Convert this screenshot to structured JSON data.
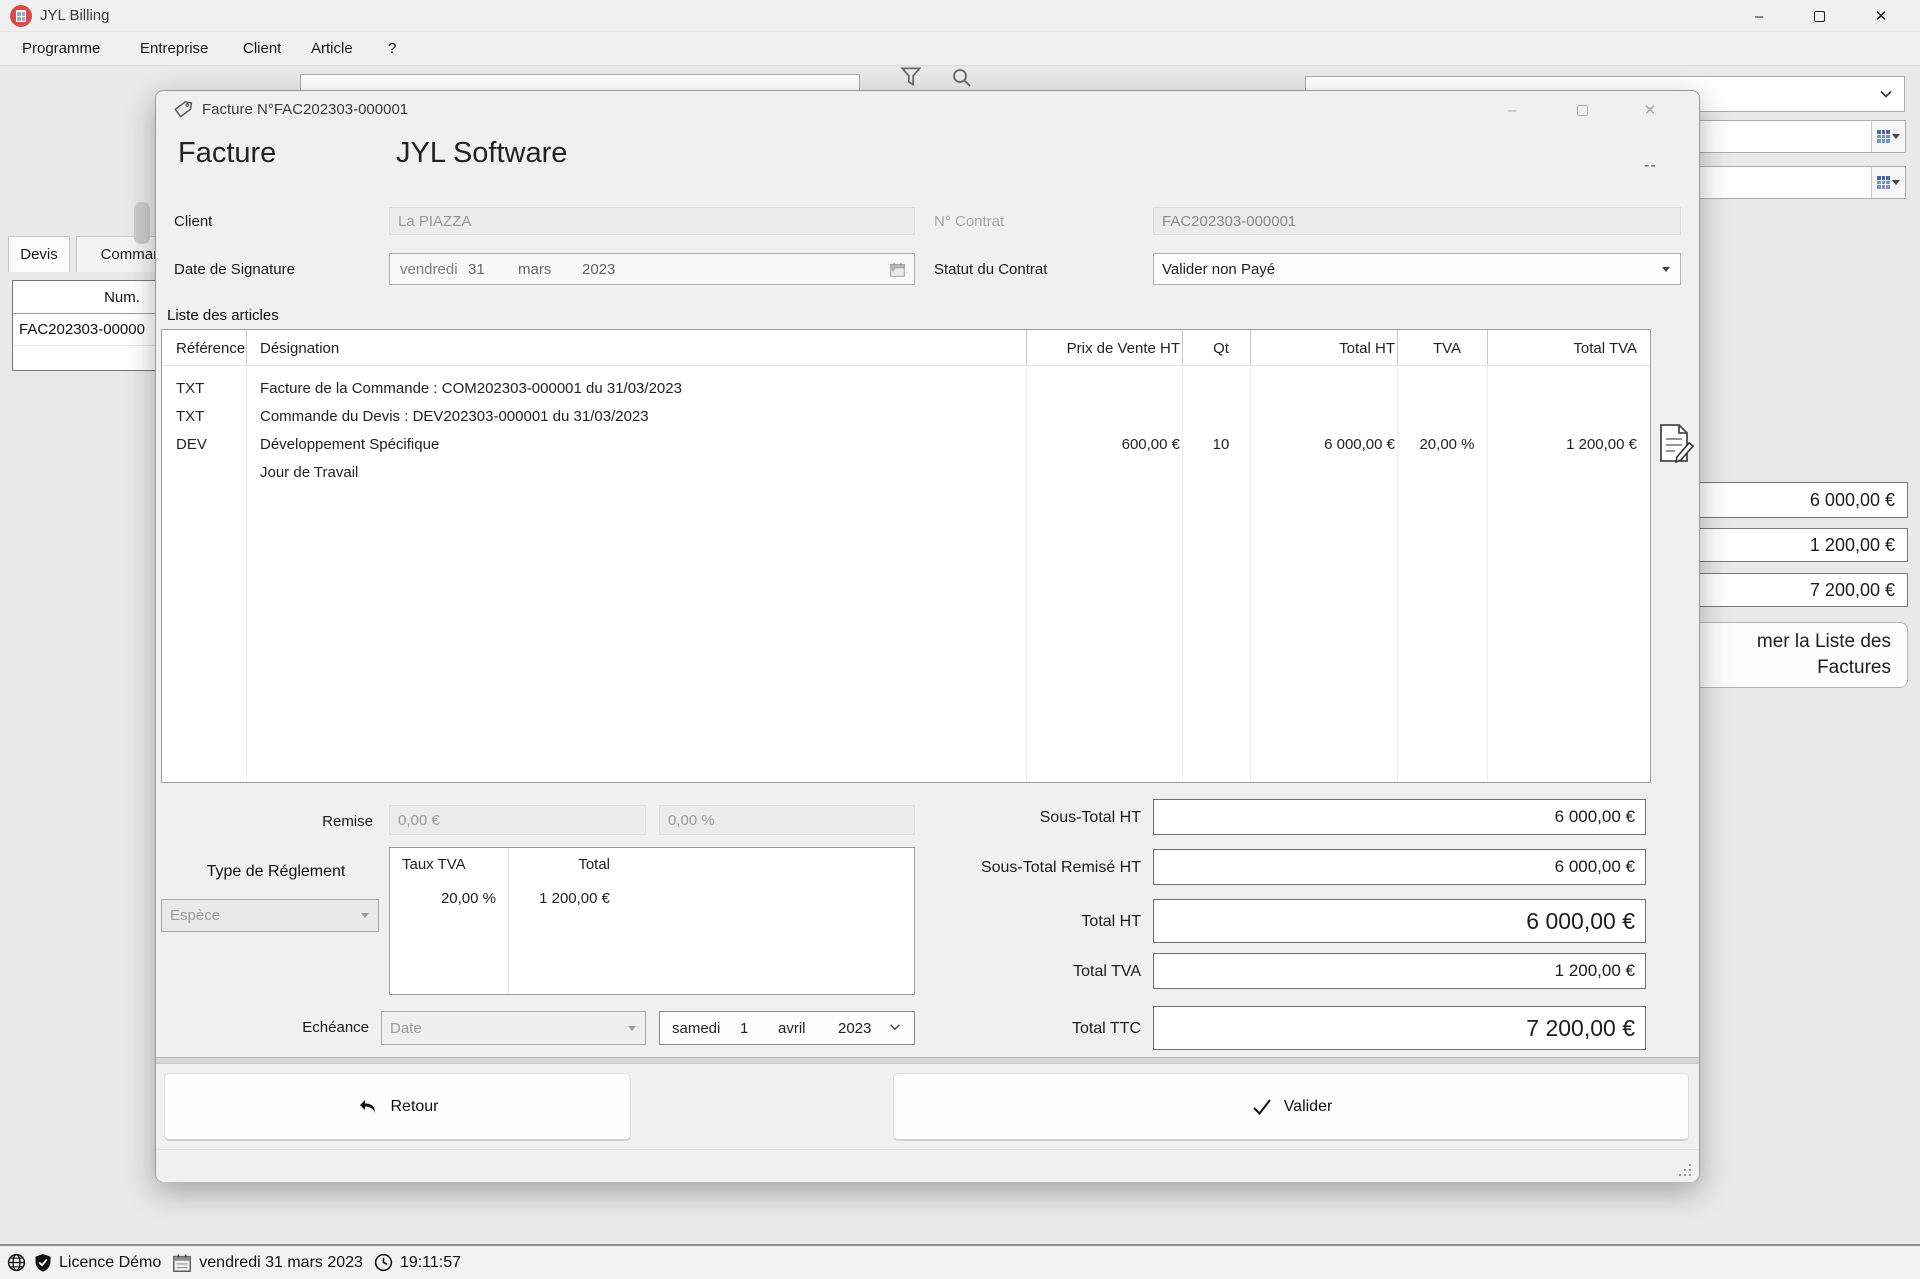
{
  "colors": {
    "window_bg": "#f0f0f0",
    "content_bg": "#e9e9e9",
    "app_icon_red": "#d84b4b",
    "field_disabled_bg": "#ebebeb",
    "border_dark": "#6f6f6f"
  },
  "app": {
    "title": "JYL Billing",
    "menu": [
      "Programme",
      "Entreprise",
      "Client",
      "Article",
      "?"
    ],
    "background": {
      "tabs": [
        "Devis",
        "Comman"
      ],
      "list": {
        "header": "Num.",
        "row": "FAC202303-00000"
      },
      "side_values": [
        "6 000,00 €",
        "1 200,00 €",
        "7 200,00 €"
      ],
      "print_button_line1": "mer la Liste des",
      "print_button_line2": "Factures"
    },
    "statusbar": {
      "licence": "Licence Démo",
      "date": "vendredi 31 mars 2023",
      "time": "19:11:57"
    }
  },
  "dialog": {
    "title": "Facture N°FAC202303-000001",
    "heading": "Facture",
    "company": "JYL Software",
    "dashes": "--",
    "fields": {
      "client_label": "Client",
      "client_value": "La PIAZZA",
      "contract_label": "N° Contrat",
      "contract_value": "FAC202303-000001",
      "signature_label": "Date de Signature",
      "signature_date": {
        "day_name": "vendredi",
        "day": "31",
        "month": "mars",
        "year": "2023"
      },
      "status_label": "Statut du Contrat",
      "status_value": "Valider non Payé"
    },
    "articles": {
      "group_title": "Liste des articles",
      "columns": [
        "Référence",
        "Désignation",
        "Prix de Vente HT",
        "Qt",
        "Total HT",
        "TVA",
        "Total TVA"
      ],
      "rows": [
        {
          "ref": "TXT",
          "designation": "Facture de la Commande : COM202303-000001 du 31/03/2023",
          "price": "",
          "qty": "",
          "total_ht": "",
          "tva": "",
          "total_tva": ""
        },
        {
          "ref": "TXT",
          "designation": "Commande du Devis : DEV202303-000001 du 31/03/2023",
          "price": "",
          "qty": "",
          "total_ht": "",
          "tva": "",
          "total_tva": ""
        },
        {
          "ref": "DEV",
          "designation": "Développement Spécifique",
          "price": "600,00 €",
          "qty": "10",
          "total_ht": "6 000,00 €",
          "tva": "20,00 %",
          "total_tva": "1 200,00 €"
        },
        {
          "ref": "",
          "designation": "Jour de Travail",
          "price": "",
          "qty": "",
          "total_ht": "",
          "tva": "",
          "total_tva": ""
        }
      ]
    },
    "remise": {
      "label": "Remise",
      "amount": "0,00 €",
      "percent": "0,00 %"
    },
    "payment": {
      "label": "Type de Réglement",
      "value": "Espèce"
    },
    "tva_table": {
      "col_rate": "Taux TVA",
      "col_total": "Total",
      "row_rate": "20,00 %",
      "row_total": "1 200,00 €"
    },
    "totals": [
      {
        "label": "Sous-Total HT",
        "value": "6 000,00 €"
      },
      {
        "label": "Sous-Total Remisé HT",
        "value": "6 000,00 €"
      },
      {
        "label": "Total HT",
        "value": "6 000,00 €"
      },
      {
        "label": "Total TVA",
        "value": "1 200,00 €"
      },
      {
        "label": "Total TTC",
        "value": "7 200,00 €"
      }
    ],
    "echeance": {
      "label": "Echéance",
      "type_value": "Date",
      "date": {
        "day_name": "samedi",
        "day": "1",
        "month": "avril",
        "year": "2023"
      }
    },
    "buttons": {
      "back": "Retour",
      "validate": "Valider"
    }
  }
}
